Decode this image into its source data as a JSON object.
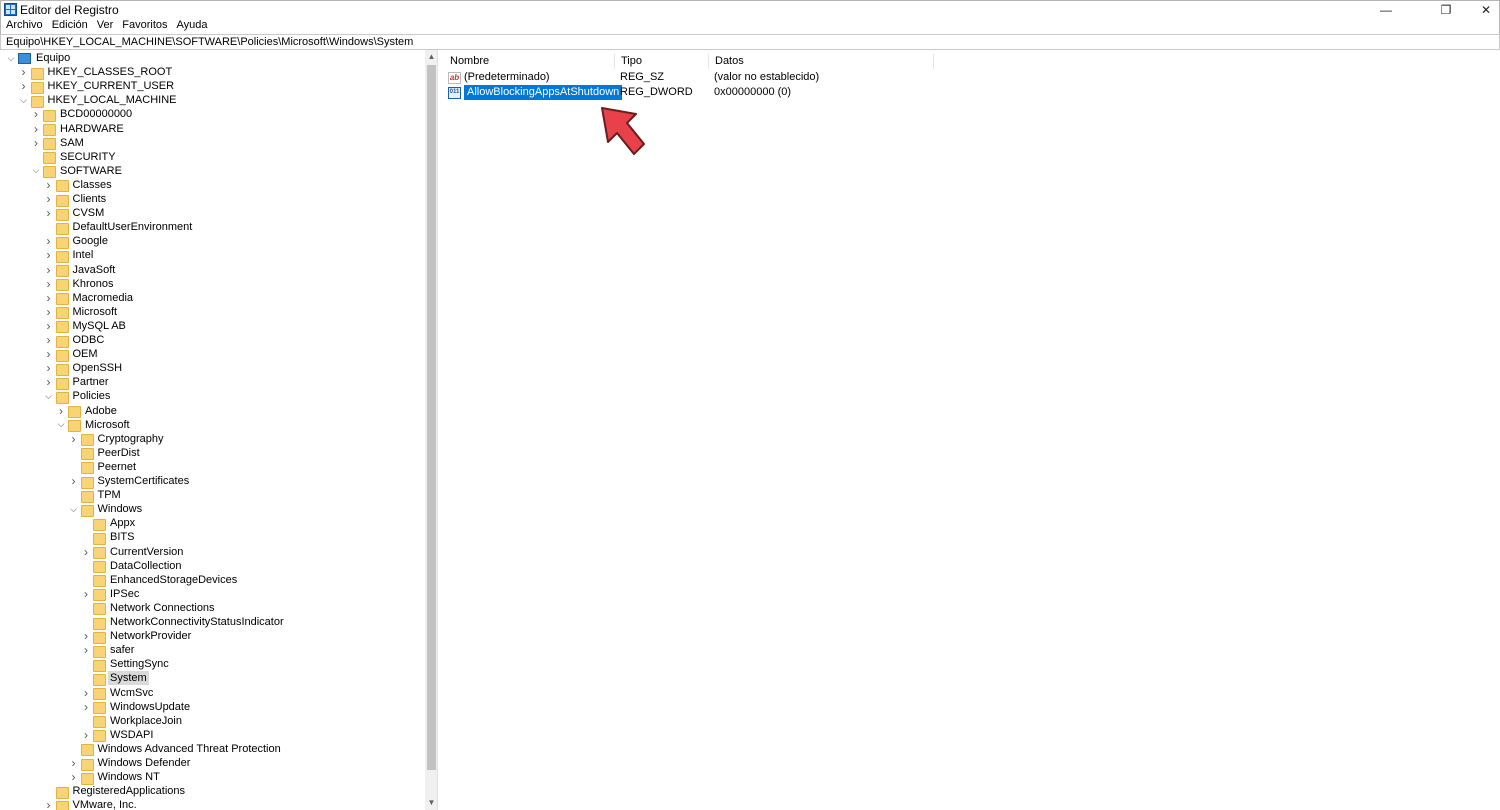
{
  "window": {
    "title": "Editor del Registro",
    "min_glyph": "—",
    "max_glyph": "❐",
    "close_glyph": "✕"
  },
  "menu": [
    "Archivo",
    "Edición",
    "Ver",
    "Favoritos",
    "Ayuda"
  ],
  "address": "Equipo\\HKEY_LOCAL_MACHINE\\SOFTWARE\\Policies\\Microsoft\\Windows\\System",
  "tree": [
    {
      "label": "Equipo",
      "level": 0,
      "chev": "down",
      "icon": "pc"
    },
    {
      "label": "HKEY_CLASSES_ROOT",
      "level": 1,
      "chev": "right"
    },
    {
      "label": "HKEY_CURRENT_USER",
      "level": 1,
      "chev": "right"
    },
    {
      "label": "HKEY_LOCAL_MACHINE",
      "level": 1,
      "chev": "down"
    },
    {
      "label": "BCD00000000",
      "level": 2,
      "chev": "right"
    },
    {
      "label": "HARDWARE",
      "level": 2,
      "chev": "right"
    },
    {
      "label": "SAM",
      "level": 2,
      "chev": "right"
    },
    {
      "label": "SECURITY",
      "level": 2,
      "chev": ""
    },
    {
      "label": "SOFTWARE",
      "level": 2,
      "chev": "down"
    },
    {
      "label": "Classes",
      "level": 3,
      "chev": "right"
    },
    {
      "label": "Clients",
      "level": 3,
      "chev": "right"
    },
    {
      "label": "CVSM",
      "level": 3,
      "chev": "right"
    },
    {
      "label": "DefaultUserEnvironment",
      "level": 3,
      "chev": ""
    },
    {
      "label": "Google",
      "level": 3,
      "chev": "right"
    },
    {
      "label": "Intel",
      "level": 3,
      "chev": "right"
    },
    {
      "label": "JavaSoft",
      "level": 3,
      "chev": "right"
    },
    {
      "label": "Khronos",
      "level": 3,
      "chev": "right"
    },
    {
      "label": "Macromedia",
      "level": 3,
      "chev": "right"
    },
    {
      "label": "Microsoft",
      "level": 3,
      "chev": "right"
    },
    {
      "label": "MySQL AB",
      "level": 3,
      "chev": "right"
    },
    {
      "label": "ODBC",
      "level": 3,
      "chev": "right"
    },
    {
      "label": "OEM",
      "level": 3,
      "chev": "right"
    },
    {
      "label": "OpenSSH",
      "level": 3,
      "chev": "right"
    },
    {
      "label": "Partner",
      "level": 3,
      "chev": "right"
    },
    {
      "label": "Policies",
      "level": 3,
      "chev": "down"
    },
    {
      "label": "Adobe",
      "level": 4,
      "chev": "right"
    },
    {
      "label": "Microsoft",
      "level": 4,
      "chev": "down"
    },
    {
      "label": "Cryptography",
      "level": 5,
      "chev": "right"
    },
    {
      "label": "PeerDist",
      "level": 5,
      "chev": ""
    },
    {
      "label": "Peernet",
      "level": 5,
      "chev": ""
    },
    {
      "label": "SystemCertificates",
      "level": 5,
      "chev": "right"
    },
    {
      "label": "TPM",
      "level": 5,
      "chev": ""
    },
    {
      "label": "Windows",
      "level": 5,
      "chev": "down"
    },
    {
      "label": "Appx",
      "level": 6,
      "chev": ""
    },
    {
      "label": "BITS",
      "level": 6,
      "chev": ""
    },
    {
      "label": "CurrentVersion",
      "level": 6,
      "chev": "right"
    },
    {
      "label": "DataCollection",
      "level": 6,
      "chev": ""
    },
    {
      "label": "EnhancedStorageDevices",
      "level": 6,
      "chev": ""
    },
    {
      "label": "IPSec",
      "level": 6,
      "chev": "right"
    },
    {
      "label": "Network Connections",
      "level": 6,
      "chev": ""
    },
    {
      "label": "NetworkConnectivityStatusIndicator",
      "level": 6,
      "chev": ""
    },
    {
      "label": "NetworkProvider",
      "level": 6,
      "chev": "right"
    },
    {
      "label": "safer",
      "level": 6,
      "chev": "right"
    },
    {
      "label": "SettingSync",
      "level": 6,
      "chev": ""
    },
    {
      "label": "System",
      "level": 6,
      "chev": "",
      "selected": true
    },
    {
      "label": "WcmSvc",
      "level": 6,
      "chev": "right"
    },
    {
      "label": "WindowsUpdate",
      "level": 6,
      "chev": "right"
    },
    {
      "label": "WorkplaceJoin",
      "level": 6,
      "chev": ""
    },
    {
      "label": "WSDAPI",
      "level": 6,
      "chev": "right"
    },
    {
      "label": "Windows Advanced Threat Protection",
      "level": 5,
      "chev": ""
    },
    {
      "label": "Windows Defender",
      "level": 5,
      "chev": "right"
    },
    {
      "label": "Windows NT",
      "level": 5,
      "chev": "right"
    },
    {
      "label": "RegisteredApplications",
      "level": 3,
      "chev": ""
    },
    {
      "label": "VMware, Inc.",
      "level": 3,
      "chev": "right"
    }
  ],
  "columns": {
    "name": "Nombre",
    "type": "Tipo",
    "data": "Datos"
  },
  "values": [
    {
      "name": "(Predeterminado)",
      "type": "REG_SZ",
      "data": "(valor no establecido)",
      "icon": "ab",
      "selected": false
    },
    {
      "name": "AllowBlockingAppsAtShutdown",
      "type": "REG_DWORD",
      "data": "0x00000000 (0)",
      "icon": "011",
      "selected": true
    }
  ],
  "colors": {
    "selection": "#0078d7",
    "folder": "#f9d477",
    "arrow": "#e8414a"
  }
}
